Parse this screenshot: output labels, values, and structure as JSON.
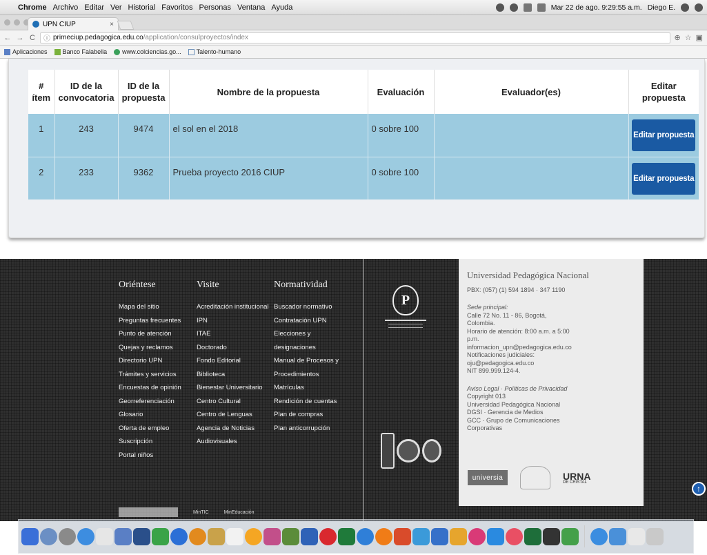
{
  "menubar": {
    "app": "Chrome",
    "items": [
      "Archivo",
      "Editar",
      "Ver",
      "Historial",
      "Favoritos",
      "Personas",
      "Ventana",
      "Ayuda"
    ],
    "datetime": "Mar 22 de ago. 9:29:55 a.m.",
    "user": "Diego E."
  },
  "browser": {
    "tab_title": "UPN CIUP",
    "url_domain": "primeciup.pedagogica.edu.co",
    "url_path": "/application/consulproyectos/index",
    "bookmarks": [
      "Aplicaciones",
      "Banco Falabella",
      "www.colciencias.go...",
      "Talento-humano"
    ]
  },
  "table": {
    "headers": [
      "#\nítem",
      "ID de la\nconvocatoria",
      "ID de la\npropuesta",
      "Nombre de la propuesta",
      "Evaluación",
      "Evaluador(es)",
      "Editar propuesta"
    ],
    "rows": [
      {
        "item": "1",
        "convocatoria": "243",
        "propuesta": "9474",
        "nombre": "el sol en el 2018",
        "evaluacion": "0 sobre 100",
        "evaluadores": "",
        "button": "Editar propuesta"
      },
      {
        "item": "2",
        "convocatoria": "233",
        "propuesta": "9362",
        "nombre": "Prueba proyecto 2016 CIUP",
        "evaluacion": "0 sobre 100",
        "evaluadores": "",
        "button": "Editar propuesta"
      }
    ]
  },
  "footer": {
    "columns": [
      {
        "title": "Oriéntese",
        "links": [
          "Mapa del sitio",
          "Preguntas frecuentes",
          "Punto de atención",
          "Quejas y reclamos",
          "Directorio UPN",
          "Trámites y servicios",
          "Encuestas de opinión",
          "Georreferenciación",
          "Glosario",
          "Oferta de empleo",
          "Suscripción",
          "Portal niños"
        ]
      },
      {
        "title": "Visite",
        "links": [
          "Acreditación institucional",
          "IPN",
          "ITAE",
          "Doctorado",
          "Fondo Editorial",
          "Biblioteca",
          "Bienestar Universitario",
          "Centro Cultural",
          "Centro de Lenguas",
          "Agencia de Noticias",
          "Audiovisuales"
        ]
      },
      {
        "title": "Normatividad",
        "links": [
          "Buscador normativo",
          "Contratación UPN",
          "Elecciones y",
          "designaciones",
          "Manual de Procesos y",
          "Procedimientos",
          "Matrículas",
          "Rendición de cuentas",
          "Plan de compras",
          "Plan anticorrupción"
        ]
      }
    ],
    "info": {
      "university": "Universidad Pedagógica Nacional",
      "pbx": "PBX: (057) (1) 594 1894 · 347 1190",
      "lines": [
        "Sede principal:",
        "Calle 72 No. 11 - 86, Bogotá,",
        "Colombia.",
        "Horario de atención: 8:00 a.m. a 5:00",
        "p.m.",
        "informacion_upn@pedagogica.edu.co",
        "Notificaciones judiciales:",
        "oju@pedagogica.edu.co",
        "NIT 899.999.124-4."
      ],
      "lines2": [
        "Aviso Legal · Políticas de Privacidad",
        "Copyright 013",
        "Universidad Pedagógica Nacional",
        "DGSI · Gerencia de Medios",
        "GCC · Grupo de Comunicaciones",
        "Corporativas"
      ],
      "logo1": "universia",
      "logo3": "URNA",
      "logo3_sub": "DE CRISTAL"
    },
    "bottom_logos": [
      "MinTIC",
      "MinEducación"
    ]
  }
}
